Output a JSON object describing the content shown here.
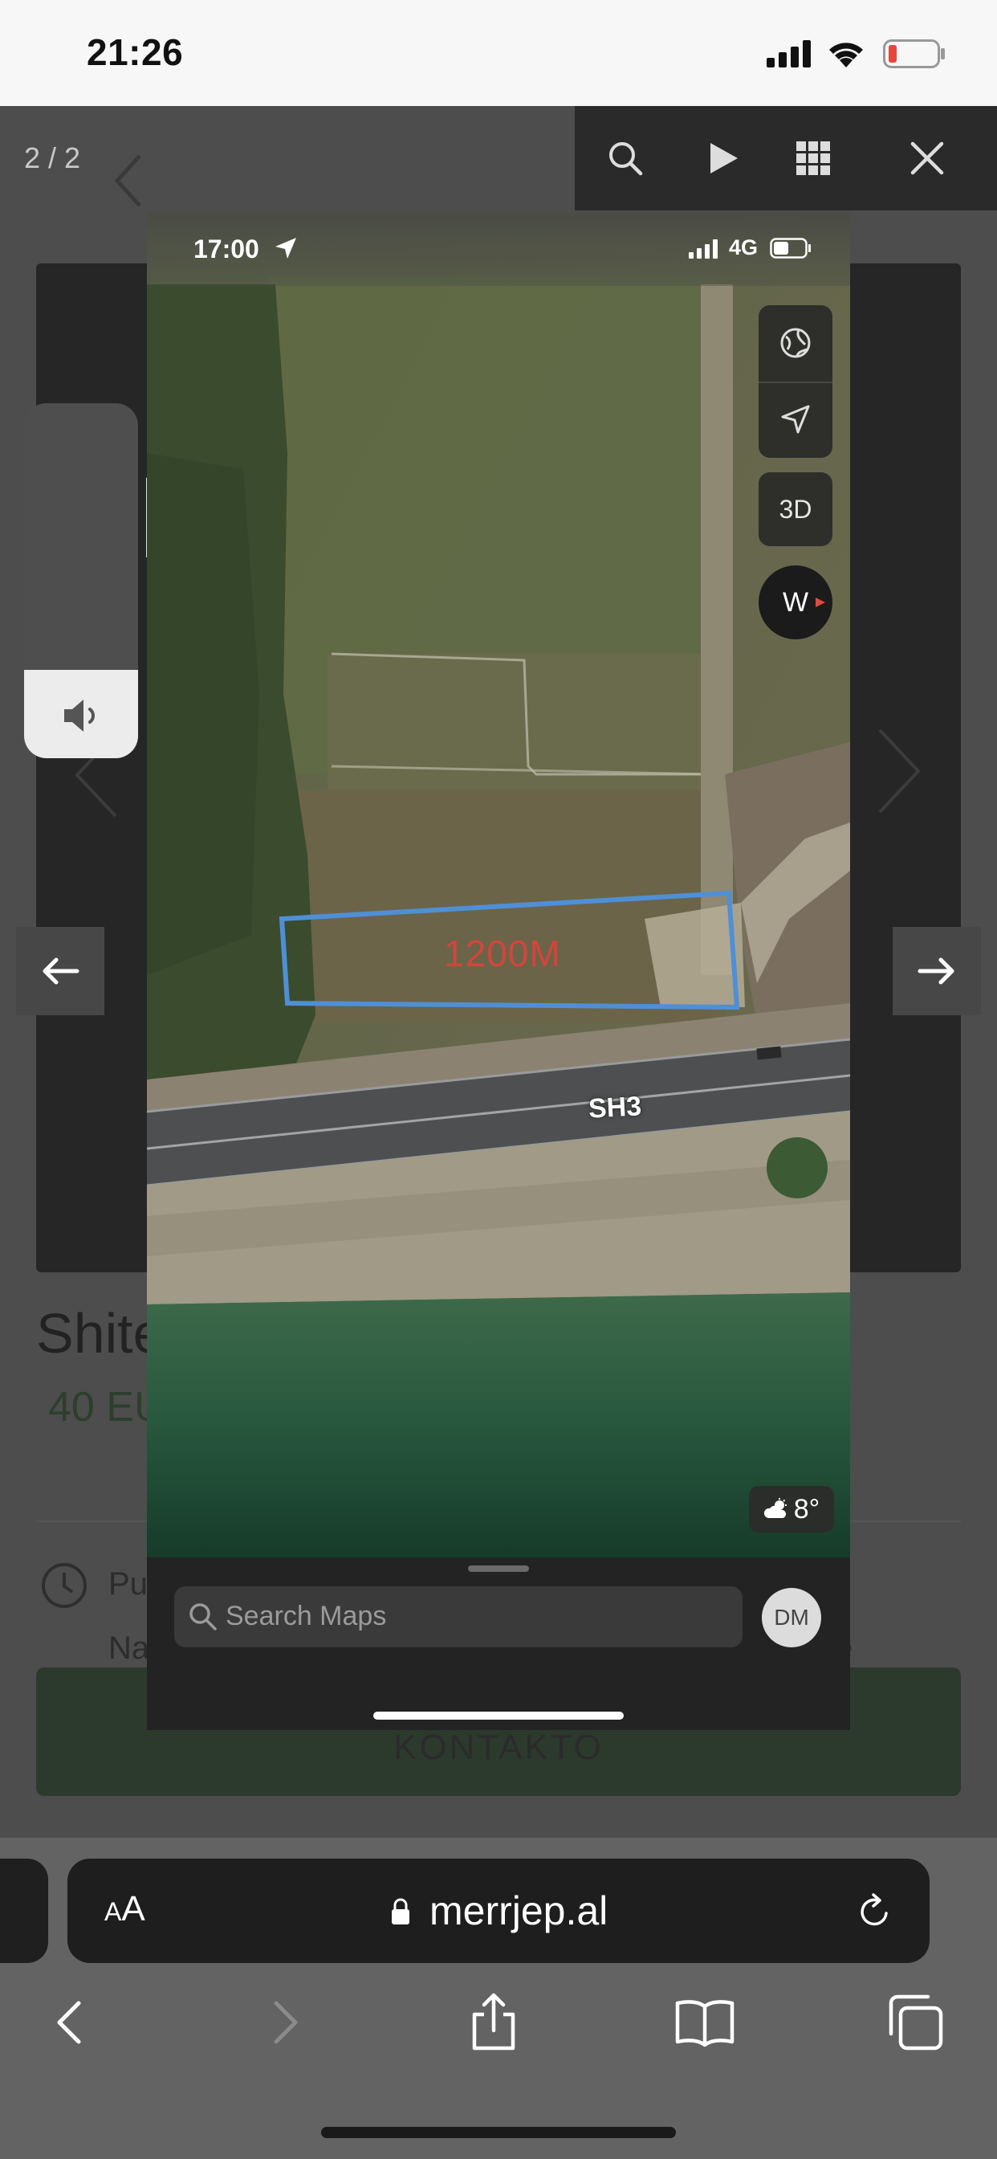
{
  "status_bar": {
    "time": "21:26",
    "battery_color": "#e5483b"
  },
  "viewer": {
    "counter": "2 / 2",
    "toolbar_icons": [
      "search-icon",
      "play-icon",
      "grid-icon",
      "close-icon"
    ]
  },
  "underlying_page": {
    "title_fragment": "Shite",
    "price_fragment": "40 EU",
    "row1_fragment": "Pu",
    "row2_fragment": "Na",
    "row2_end_fragment": "e",
    "contact_label": "KONTAKTO"
  },
  "screenshot": {
    "status_time": "17:00",
    "network": "4G",
    "map": {
      "plot_label": "1200M",
      "plot_outline_color": "#4f8fd6",
      "plot_label_color": "#d4453c",
      "road_label": "SH3",
      "compass_letter": "W",
      "btn_3d": "3D",
      "weather_temp": "8°"
    },
    "search_placeholder": "Search Maps",
    "avatar_initials": "DM"
  },
  "browser": {
    "aa_label": "A",
    "aa_label_large": "A",
    "url": "merrjep.al"
  }
}
